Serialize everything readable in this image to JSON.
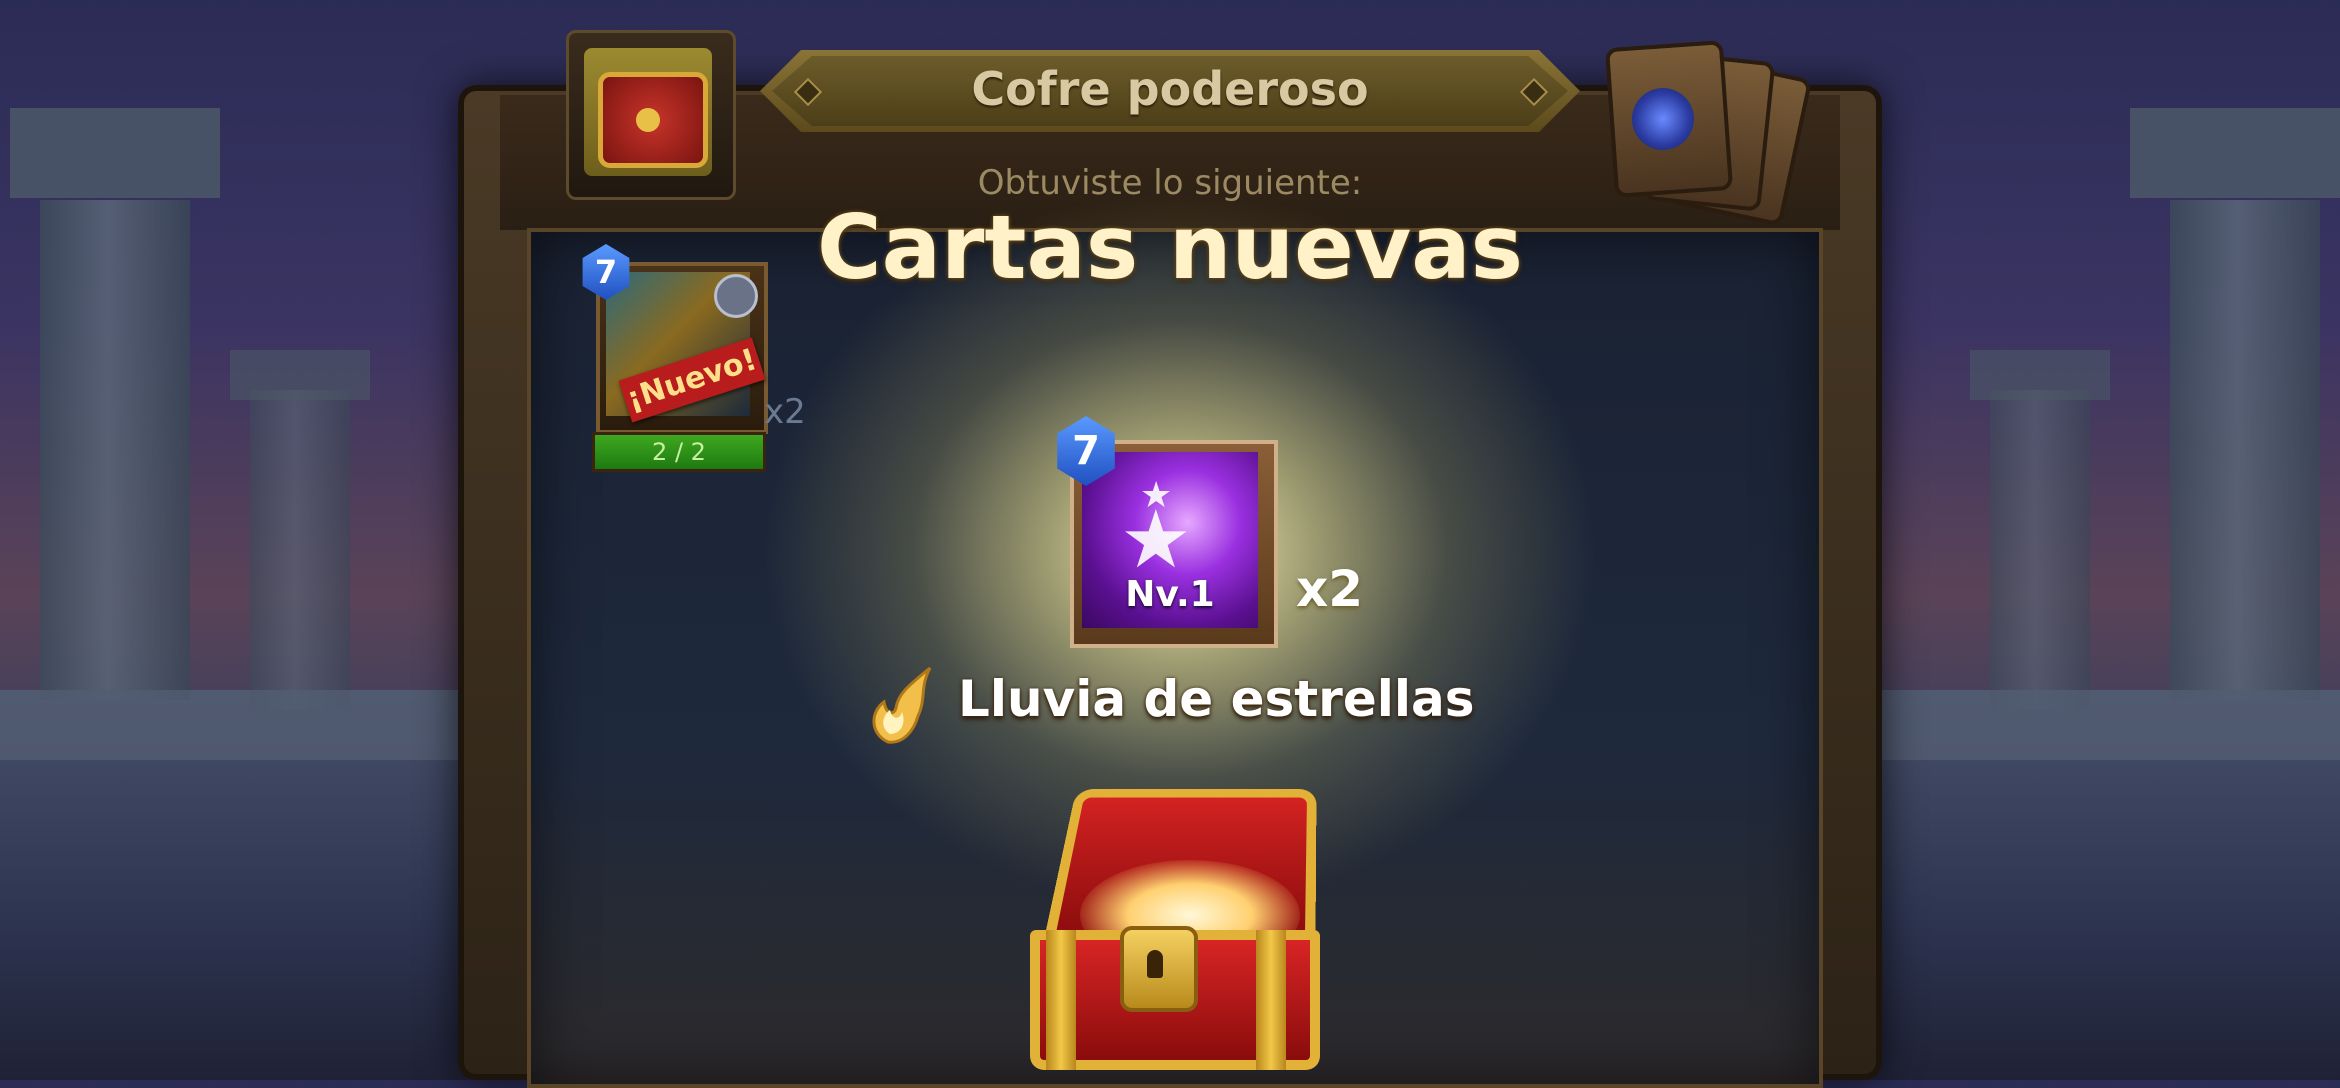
{
  "dialog": {
    "title": "Cofre poderoso",
    "subtitle": "Obtuviste lo siguiente:",
    "heading": "Cartas nuevas"
  },
  "received_card": {
    "level_badge": "7",
    "new_tag": "¡Nuevo!",
    "quantity": "x2",
    "progress_text": "2 / 2",
    "progress_fraction": 1.0
  },
  "featured_card": {
    "level_badge": "7",
    "level_label": "Nv.1",
    "quantity": "x2",
    "skill_name": "Lluvia de estrellas"
  },
  "icons": {
    "chest": "treasure-chest-icon",
    "cards": "card-stack-icon",
    "skill": "fire-icon",
    "star": "star-icon"
  },
  "colors": {
    "heading": "#fff2c8",
    "subtitle": "#9c8a62",
    "progress": "#3ea820",
    "badge": "#2050c0"
  }
}
